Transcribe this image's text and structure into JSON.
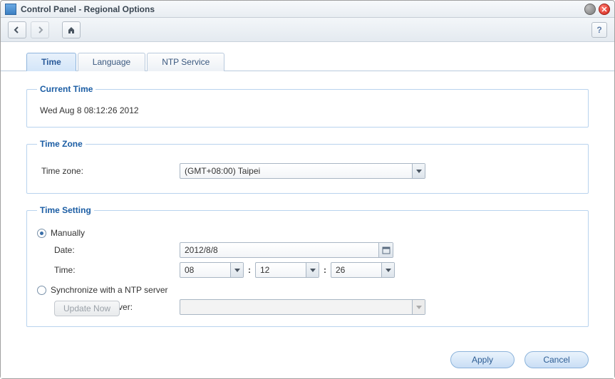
{
  "window": {
    "title": "Control Panel - Regional Options"
  },
  "toolbar": {
    "help_label": "?"
  },
  "tabs": [
    {
      "label": "Time",
      "active": true
    },
    {
      "label": "Language",
      "active": false
    },
    {
      "label": "NTP Service",
      "active": false
    }
  ],
  "groups": {
    "current_time": {
      "legend": "Current Time",
      "value": "Wed Aug 8 08:12:26 2012"
    },
    "time_zone": {
      "legend": "Time Zone",
      "label": "Time zone:",
      "value": "(GMT+08:00) Taipei"
    },
    "time_setting": {
      "legend": "Time Setting",
      "manual_label": "Manually",
      "date_label": "Date:",
      "date_value": "2012/8/8",
      "time_label": "Time:",
      "hour": "08",
      "minute": "12",
      "second": "26",
      "separator": ":",
      "ntp_label": "Synchronize with a NTP server",
      "nts_label": "Network time server:",
      "nts_value": "",
      "update_now": "Update Now",
      "mode": "manual"
    }
  },
  "footer": {
    "apply": "Apply",
    "cancel": "Cancel"
  }
}
